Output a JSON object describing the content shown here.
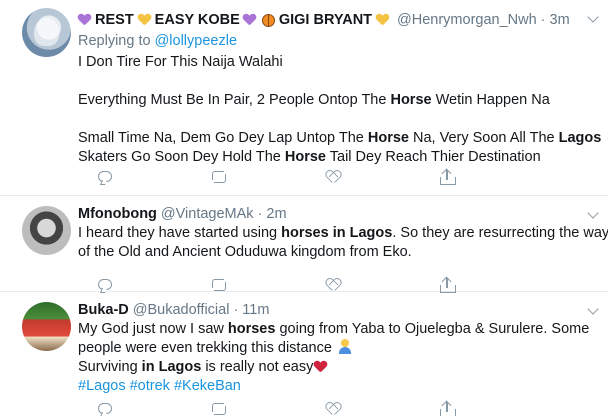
{
  "tweets": [
    {
      "display_name_parts": [
        "REST",
        "EASY KOBE",
        "GIGI BRYANT"
      ],
      "handle": "@Henrymorgan_Nwh",
      "time": "3m",
      "replying_prefix": "Replying to",
      "replying_to": "@lollypeezle",
      "lines": [
        [
          "I Don Tire For This Naija Walahi"
        ],
        [],
        [
          "Everything Must Be In Pair, 2 People Ontop The ",
          {
            "b": "Horse"
          },
          " Wetin Happen Na"
        ],
        [],
        [
          "Small Time Na, Dem Go Dey Lap Untop The ",
          {
            "b": "Horse"
          },
          " Na, Very Soon All The ",
          {
            "b": "Lagos"
          }
        ],
        [
          "Skaters Go Soon Dey Hold The ",
          {
            "b": "Horse"
          },
          " Tail Dey Reach Thier Destination"
        ]
      ],
      "colors": {
        "purple_heart": "#a974d6",
        "yellow_heart": "#f5c342"
      }
    },
    {
      "display_name": "Mfonobong",
      "handle": "@VintageMAk",
      "dot": "·",
      "time": "2m",
      "lines": [
        [
          "I heard they have started using ",
          {
            "b": "horses in Lagos"
          },
          ". So they are resurrecting the ways"
        ],
        [
          "of the Old and Ancient Oduduwa kingdom from Eko."
        ]
      ]
    },
    {
      "display_name": "Buka-D",
      "handle": "@Bukadofficial",
      "dot": "·",
      "time": "11m",
      "lines": [
        [
          "My God just now I saw ",
          {
            "b": "horses"
          },
          " going from Yaba to Ojuelegba & Surulere. Some"
        ],
        [
          "people were even trekking this distance "
        ],
        [
          "Surviving ",
          {
            "b": "in Lagos"
          },
          " is really not easy"
        ]
      ],
      "hashtags": [
        "#Lagos",
        "#otrek",
        "#KekeBan"
      ]
    }
  ],
  "icons": {
    "reply": "reply-icon",
    "retweet": "retweet-icon",
    "like": "like-icon",
    "share": "share-icon",
    "caret": "chevron-down-icon"
  },
  "colors": {
    "link": "#1b95e0",
    "muted": "#657786",
    "divider": "#e6ecf0",
    "icon": "#8899a6"
  }
}
